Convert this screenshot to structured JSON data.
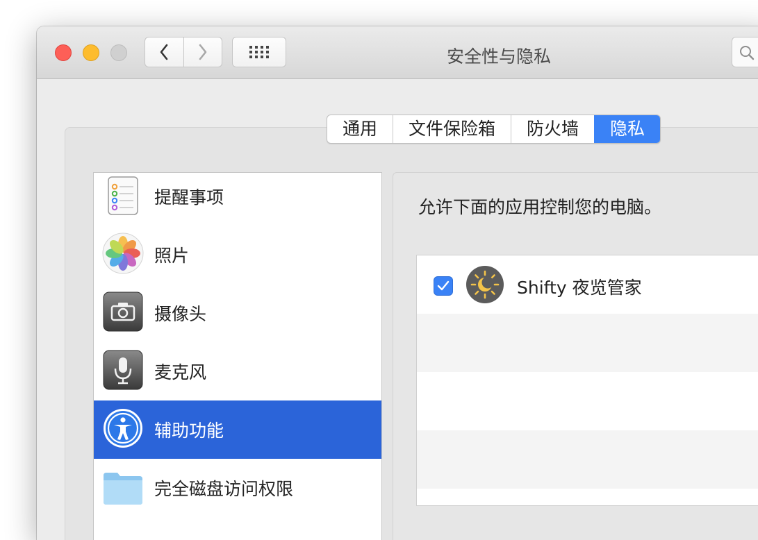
{
  "window": {
    "title": "安全性与隐私"
  },
  "tabs": [
    {
      "label": "通用",
      "active": false
    },
    {
      "label": "文件保险箱",
      "active": false
    },
    {
      "label": "防火墙",
      "active": false
    },
    {
      "label": "隐私",
      "active": true
    }
  ],
  "sidebar": {
    "items": [
      {
        "label": "提醒事项",
        "icon": "reminders-icon",
        "selected": false
      },
      {
        "label": "照片",
        "icon": "photos-icon",
        "selected": false
      },
      {
        "label": "摄像头",
        "icon": "camera-icon",
        "selected": false
      },
      {
        "label": "麦克风",
        "icon": "microphone-icon",
        "selected": false
      },
      {
        "label": "辅助功能",
        "icon": "accessibility-icon",
        "selected": true
      },
      {
        "label": "完全磁盘访问权限",
        "icon": "folder-icon",
        "selected": false
      }
    ]
  },
  "main": {
    "description": "允许下面的应用控制您的电脑。",
    "apps": [
      {
        "name": "Shifty 夜览管家",
        "checked": true,
        "icon": "shifty-sun-moon-icon"
      }
    ]
  },
  "colors": {
    "accent": "#3a82f6",
    "selection": "#2b64d9"
  }
}
